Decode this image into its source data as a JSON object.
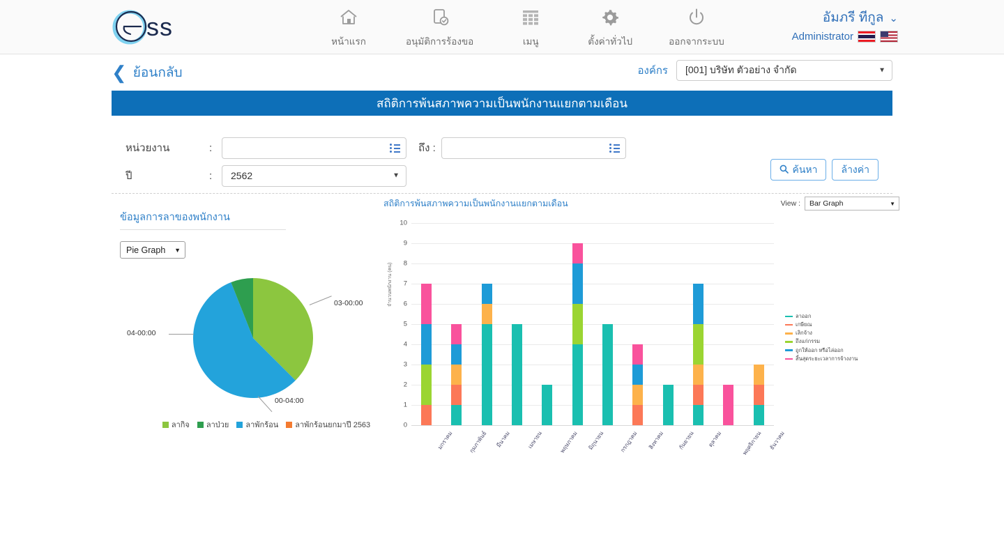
{
  "header": {
    "logo_text": "ss",
    "logo_icon": "ess-logo-icon",
    "nav": [
      {
        "label": "หน้าแรก",
        "icon": "home-icon"
      },
      {
        "label": "อนุมัติการร้องขอ",
        "icon": "document-check-icon"
      },
      {
        "label": "เมนู",
        "icon": "grid-menu-icon"
      },
      {
        "label": "ตั้งค่าทั่วไป",
        "icon": "gear-icon"
      },
      {
        "label": "ออกจากระบบ",
        "icon": "power-icon"
      }
    ],
    "user_name": "อัมภรี ทีกูล",
    "user_role": "Administrator",
    "chevron": "⌄",
    "flags": [
      "flag-th",
      "flag-us"
    ]
  },
  "subheader": {
    "back_label": "ย้อนกลับ",
    "back_chevron": "❮",
    "org_label": "องค์กร",
    "org_value": "[001] บริษัท ตัวอย่าง จำกัด"
  },
  "banner": {
    "title": "สถิติการพ้นสภาพความเป็นพนักงานแยกตามเดือน"
  },
  "filters": {
    "dept_label": "หน่วยงาน",
    "dept_value": "",
    "dept_placeholder": "",
    "colon": ":",
    "to_label": "ถึง :",
    "to_value": "",
    "to_placeholder": "",
    "year_label": "ปี",
    "year_value": "2562",
    "search_label": "ค้นหา",
    "search_icon": "magnifier-icon",
    "clear_label": "ล้างค่า"
  },
  "pie_panel": {
    "title": "ข้อมูลการลาของพนักงาน",
    "graph_type": "Pie Graph"
  },
  "bar_panel": {
    "title": "สถิติการพ้นสภาพความเป็นพนักงานแยกตามเดือน",
    "view_label": "View :",
    "view_value": "Bar Graph"
  },
  "chart_data": [
    {
      "type": "pie",
      "title": "ข้อมูลการลาของพนักงาน",
      "categories": [
        "ลากิจ",
        "ลาป่วย",
        "ลาพักร้อน",
        "ลาพักร้อนยกมาปี 2563"
      ],
      "colors": [
        "#8CC63F",
        "#2E9E4F",
        "#23A3DB",
        "#F47B30"
      ],
      "slices": [
        {
          "name": "ลากิจ",
          "label": "03-00:00",
          "value": 37.5,
          "color": "#8CC63F"
        },
        {
          "name": "ลาป่วย",
          "label": "00-04:00",
          "value": 6.0,
          "color": "#2E9E4F"
        },
        {
          "name": "ลาพักร้อน",
          "label": "04-00:00",
          "value": 56.5,
          "color": "#23A3DB"
        },
        {
          "name": "ลาพักร้อนยกมาปี 2563",
          "label": "",
          "value": 0,
          "color": "#F47B30"
        }
      ],
      "legend_position": "bottom"
    },
    {
      "type": "bar",
      "stacked": true,
      "title": "สถิติการพ้นสภาพความเป็นพนักงานแยกตามเดือน",
      "ylabel": "จำนวนพนักงาน (คน)",
      "xlabel": "",
      "ylim": [
        0,
        10
      ],
      "yticks": [
        0,
        1,
        2,
        3,
        4,
        5,
        6,
        7,
        8,
        9,
        10
      ],
      "grid": true,
      "legend_position": "right",
      "categories": [
        "มกราคม",
        "กุมภาพันธ์",
        "มีนาคม",
        "เมษายน",
        "พฤษภาคม",
        "มิถุนายน",
        "กรกฎาคม",
        "สิงหาคม",
        "กันยายน",
        "ตุลาคม",
        "พฤศจิกายน",
        "ธันวาคม"
      ],
      "series": [
        {
          "name": "ลาออก",
          "color": "#1ABFB0",
          "values": [
            0,
            1,
            5,
            5,
            2,
            4,
            5,
            0,
            2,
            1,
            0,
            1
          ]
        },
        {
          "name": "เกษียณ",
          "color": "#FC7857",
          "values": [
            1,
            1,
            0,
            0,
            0,
            0,
            0,
            1,
            0,
            1,
            0,
            1
          ]
        },
        {
          "name": "เลิกจ้าง",
          "color": "#FDB24B",
          "values": [
            0,
            1,
            1,
            0,
            0,
            0,
            0,
            1,
            0,
            1,
            0,
            1
          ]
        },
        {
          "name": "ถึงแก่กรรม",
          "color": "#9BD532",
          "values": [
            2,
            0,
            0,
            0,
            0,
            2,
            0,
            0,
            0,
            2,
            0,
            0
          ]
        },
        {
          "name": "ถูกให้ออก หรือไล่ออก",
          "color": "#1E9BD7",
          "values": [
            2,
            1,
            1,
            0,
            0,
            2,
            0,
            1,
            0,
            2,
            0,
            0
          ]
        },
        {
          "name": "สิ้นสุดระยะเวลาการจ้างงาน",
          "color": "#F9529C",
          "values": [
            2,
            1,
            0,
            0,
            0,
            1,
            0,
            1,
            0,
            0,
            2,
            0
          ]
        }
      ],
      "totals": [
        7,
        5,
        7,
        5,
        2,
        9,
        5,
        4,
        2,
        7,
        2,
        3
      ]
    }
  ]
}
